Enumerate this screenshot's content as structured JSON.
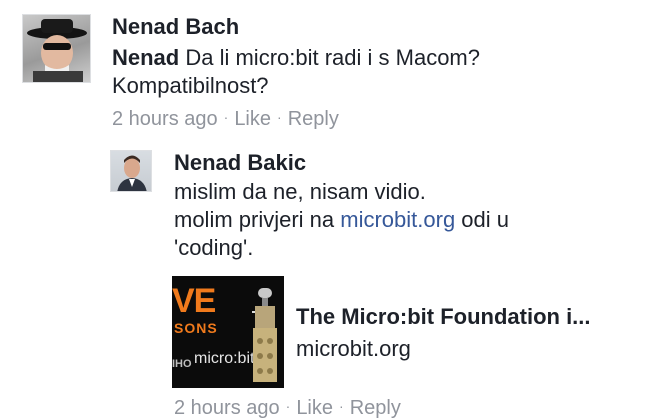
{
  "comments": [
    {
      "author": "Nenad Bach",
      "text_prefix_name": "Nenad",
      "text_line1": " Da li micro:bit radi i s Macom?",
      "text_line2": "Kompatibilnost?",
      "time": "2 hours ago",
      "like_label": "Like",
      "reply_label": "Reply"
    },
    {
      "author": "Nenad Bakic",
      "text_line1": "mislim da ne, nisam vidio.",
      "text_line2_before": "molim privjeri na ",
      "text_line2_link": "microbit.org",
      "text_line2_after": " odi u",
      "text_line3": "'coding'.",
      "preview": {
        "thumb_big": "VE",
        "thumb_small": "SONS",
        "thumb_tiny": "IHO",
        "thumb_logo": "micro:bit",
        "title": "The Micro:bit Foundation i...",
        "domain": "microbit.org"
      },
      "time": "2 hours ago",
      "like_label": "Like",
      "reply_label": "Reply"
    }
  ],
  "separator": "·"
}
